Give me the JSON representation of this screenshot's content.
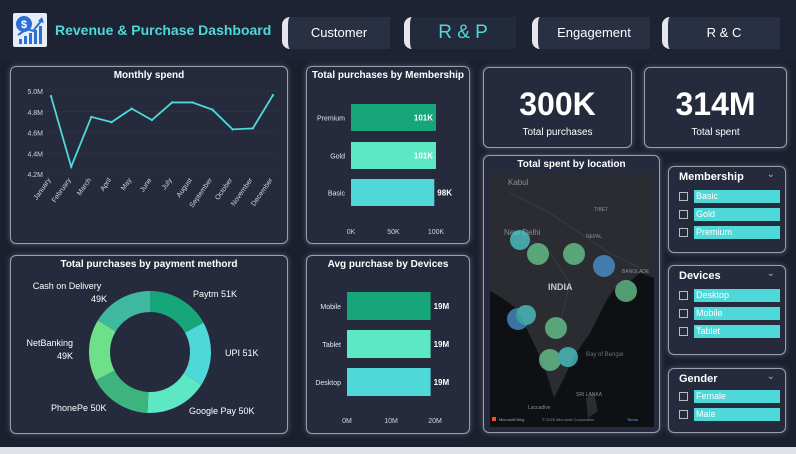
{
  "header": {
    "title": "Revenue & Purchase Dashboard",
    "tabs": [
      {
        "label": "Customer"
      },
      {
        "label": "R & P"
      },
      {
        "label": "Engagement"
      },
      {
        "label": "R & C"
      }
    ]
  },
  "colors": {
    "teal": "#4fd8d8",
    "green": "#17a57a",
    "mint": "#5de8c4",
    "background": "#1b1f2e",
    "panel": "#252b3d"
  },
  "monthly_spend": {
    "title": "Monthly spend",
    "chart_data": {
      "type": "line",
      "categories": [
        "January",
        "February",
        "March",
        "April",
        "May",
        "June",
        "July",
        "August",
        "September",
        "October",
        "November",
        "December"
      ],
      "values": [
        4.95,
        4.27,
        4.75,
        4.7,
        4.83,
        4.72,
        4.89,
        4.89,
        4.82,
        4.63,
        4.64,
        4.96
      ],
      "ylim": [
        4.2,
        5.0
      ],
      "yticks": [
        "4.2M",
        "4.4M",
        "4.6M",
        "4.8M",
        "5.0M"
      ],
      "ytick_values": [
        4.2,
        4.4,
        4.6,
        4.8,
        5.0
      ]
    }
  },
  "membership_chart": {
    "title": "Total purchases by Membership",
    "chart_data": {
      "type": "bar",
      "categories": [
        "Premium",
        "Gold",
        "Basic"
      ],
      "values": [
        101,
        101,
        98
      ],
      "labels": [
        "101K",
        "101K",
        "98K"
      ],
      "colors": [
        "#17a57a",
        "#5de8c4",
        "#4fd8d8"
      ],
      "xlim": [
        0,
        100
      ],
      "xticks": [
        "0K",
        "50K",
        "100K"
      ],
      "xtick_values": [
        0,
        50,
        100
      ]
    }
  },
  "kpis": {
    "purchases": {
      "value": "300K",
      "label": "Total purchases"
    },
    "spent": {
      "value": "314M",
      "label": "Total spent"
    }
  },
  "payment_chart": {
    "title": "Total purchases by payment methord",
    "chart_data": {
      "type": "pie",
      "labels": [
        "Paytm 51K",
        "UPI 51K",
        "Google Pay 50K",
        "PhonePe 50K",
        "NetBanking",
        "Cash on Delivery"
      ],
      "values": [
        51,
        51,
        50,
        50,
        49,
        49
      ],
      "colors": [
        "#17a57a",
        "#4fd8d8",
        "#5de8c4",
        "#3db37d",
        "#6fe08a",
        "#3fb8a0"
      ],
      "extra_labels": {
        "netbanking_value": "49K",
        "cod_value": "49K"
      }
    }
  },
  "devices_chart": {
    "title": "Avg purchase by Devices",
    "chart_data": {
      "type": "bar",
      "categories": [
        "Mobile",
        "Tablet",
        "Desktop"
      ],
      "values": [
        19,
        19,
        19
      ],
      "labels": [
        "19M",
        "19M",
        "19M"
      ],
      "colors": [
        "#17a57a",
        "#5de8c4",
        "#4fd8d8"
      ],
      "xlim": [
        0,
        20
      ],
      "xticks": [
        "0M",
        "10M",
        "20M"
      ],
      "xtick_values": [
        0,
        10,
        20
      ]
    }
  },
  "map": {
    "title": "Total spent by location",
    "labels": {
      "kabul": "Kabul",
      "tibet": "TIBET",
      "new_delhi": "New Delhi",
      "nepal": "NEPAL",
      "bangladesh": "BANGLADE",
      "india": "INDIA",
      "bay": "Bay of Bengal",
      "sri_lanka": "SRI LANKA",
      "laccadive": "Laccadive",
      "copyright": "© 2025 Microsoft Corporation",
      "terms": "Terms",
      "bing": "Microsoft Bing"
    }
  },
  "slicers": {
    "membership": {
      "title": "Membership",
      "options": [
        "Basic",
        "Gold",
        "Premium"
      ]
    },
    "devices": {
      "title": "Devices",
      "options": [
        "Desktop",
        "Mobile",
        "Tablet"
      ]
    },
    "gender": {
      "title": "Gender",
      "options": [
        "Female",
        "Male"
      ]
    }
  },
  "icons": {
    "logo": "dollar-growth-icon",
    "chevron": "chevron-down-icon"
  }
}
